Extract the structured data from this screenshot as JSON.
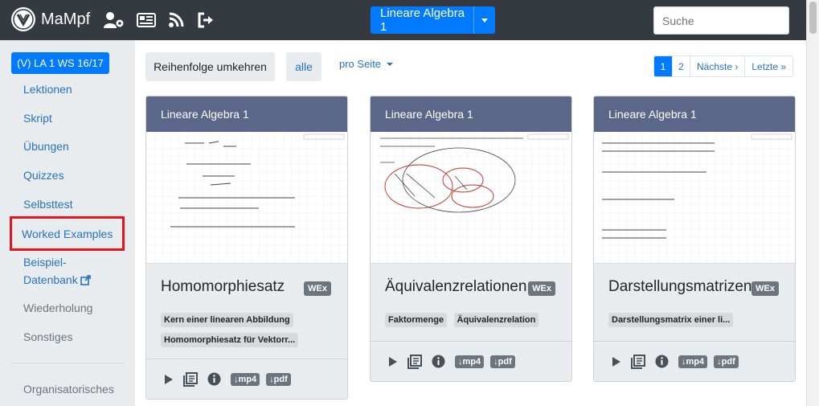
{
  "navbar": {
    "brand": "MaMpf",
    "course_button": "Lineare Algebra 1",
    "search_placeholder": "Suche",
    "icons": [
      "user-cog-icon",
      "news-icon",
      "feed-icon",
      "logout-icon"
    ]
  },
  "sidebar": {
    "lecture_badge": "(V) LA 1 WS 16/17",
    "items": [
      {
        "label": "Lektionen"
      },
      {
        "label": "Skript"
      },
      {
        "label": "Übungen"
      },
      {
        "label": "Quizzes"
      },
      {
        "label": "Selbsttest"
      },
      {
        "label": "Worked Examples"
      },
      {
        "label": "Beispiel-"
      },
      {
        "label": "Datenbank"
      },
      {
        "label": "Wiederholung"
      },
      {
        "label": "Sonstiges"
      },
      {
        "label": "Organisatorisches"
      }
    ]
  },
  "toolbar": {
    "reverse": "Reihenfolge umkehren",
    "all": "alle",
    "per_page": "pro Seite"
  },
  "pagination": {
    "pages": [
      "1",
      "2"
    ],
    "next": "Nächste ›",
    "last": "Letzte »"
  },
  "cards": [
    {
      "course": "Lineare Algebra 1",
      "title": "Homomorphiesatz",
      "badge": "WEx",
      "tags": [
        "Kern einer linearen Abbildung",
        "Homomorphiesatz für Vektorr..."
      ],
      "downloads": [
        "↓mp4",
        "↓pdf"
      ]
    },
    {
      "course": "Lineare Algebra 1",
      "title": "Äquivalenzrelationen",
      "badge": "WEx",
      "tags": [
        "Faktormenge",
        "Äquivalenzrelation"
      ],
      "downloads": [
        "↓mp4",
        "↓pdf"
      ]
    },
    {
      "course": "Lineare Algebra 1",
      "title": "Darstellungsmatrizen",
      "badge": "WEx",
      "tags": [
        "Darstellungsmatrix einer li..."
      ],
      "downloads": [
        "↓mp4",
        "↓pdf"
      ]
    }
  ],
  "colors": {
    "navbar": "#343a40",
    "primary": "#007bff",
    "card_header": "#5a6788",
    "highlight": "#e6141e"
  }
}
